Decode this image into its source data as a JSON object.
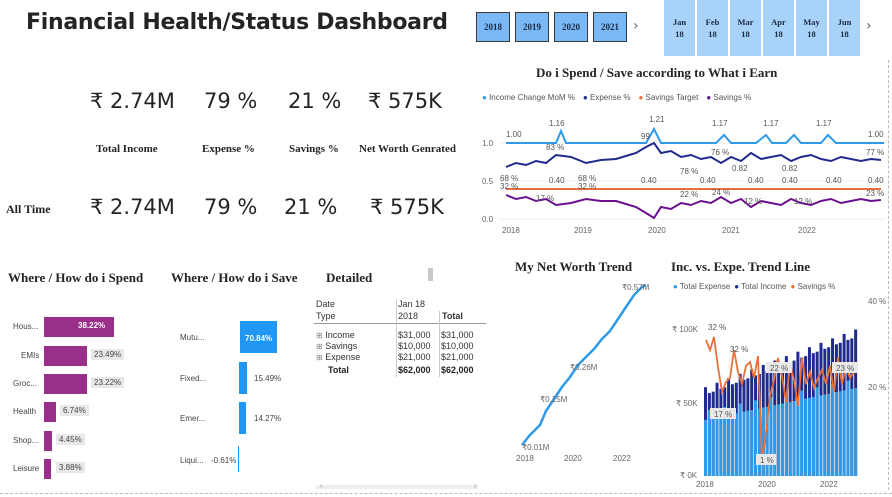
{
  "title": "Financial Health/Status Dashboard",
  "years": [
    "2018",
    "2019",
    "2020",
    "2021"
  ],
  "months": [
    {
      "m": "Jan",
      "y": "18"
    },
    {
      "m": "Feb",
      "y": "18"
    },
    {
      "m": "Mar",
      "y": "18"
    },
    {
      "m": "Apr",
      "y": "18"
    },
    {
      "m": "May",
      "y": "18"
    },
    {
      "m": "Jun",
      "y": "18"
    }
  ],
  "kpi": {
    "income": "₹ 2.74M",
    "expense": "79 %",
    "savings": "21 %",
    "networth": "₹ 575K",
    "income_lbl": "Total Income",
    "expense_lbl": "Expense %",
    "savings_lbl": "Savings %",
    "networth_lbl": "Net Worth Genrated",
    "alltime_lbl": "All Time",
    "income2": "₹ 2.74M",
    "expense2": "79 %",
    "savings2": "21 %",
    "networth2": "₹ 575K"
  },
  "colors": {
    "lightblue": "#2f9be8",
    "navy": "#1f2a8c",
    "orange": "#e8703a",
    "purple": "#6a0f8e",
    "magenta": "#9a2f8a",
    "blue": "#2196f3"
  },
  "spend": {
    "title": "Where / How do i Spend",
    "items": [
      {
        "label": "Hous...",
        "value": 38.22,
        "text": "38.22%"
      },
      {
        "label": "EMIs",
        "value": 23.49,
        "text": "23.49%"
      },
      {
        "label": "Groc...",
        "value": 23.22,
        "text": "23.22%"
      },
      {
        "label": "Health",
        "value": 6.74,
        "text": "6.74%"
      },
      {
        "label": "Shop...",
        "value": 4.45,
        "text": "4.45%"
      },
      {
        "label": "Leisure",
        "value": 3.88,
        "text": "3.88%"
      }
    ]
  },
  "save": {
    "title": "Where / How do i Save",
    "items": [
      {
        "label": "Mutu...",
        "value": 70.84,
        "text": "70.84%"
      },
      {
        "label": "Fixed...",
        "value": 15.49,
        "text": "15.49%"
      },
      {
        "label": "Emer...",
        "value": 14.27,
        "text": "14.27%"
      },
      {
        "label": "Liqui...",
        "value": -0.61,
        "text": "-0.61%"
      }
    ]
  },
  "detailed": {
    "title": "Detailed",
    "h1": "Date",
    "h2": "Type",
    "col_date": "Jan 18",
    "col_year": "2018",
    "col_total": "Total",
    "rows": [
      {
        "name": "Income",
        "v": "$31,000",
        "t": "$31,000"
      },
      {
        "name": "Savings",
        "v": "$10,000",
        "t": "$10,000"
      },
      {
        "name": "Expense",
        "v": "$21,000",
        "t": "$21,000"
      }
    ],
    "total": {
      "name": "Total",
      "v": "$62,000",
      "t": "$62,000"
    }
  },
  "line_chart": {
    "title": "Do i Spend / Save according to What i Earn",
    "legend": [
      "Income Change MoM %",
      "Expense %",
      "Savings Target",
      "Savings %"
    ],
    "y_ticks": [
      "1.0",
      "0.5",
      "0.0"
    ],
    "x_ticks": [
      "2018",
      "2019",
      "2020",
      "2021",
      "2022"
    ],
    "labels": [
      "1.00",
      "1.16",
      "1.21",
      "1.17",
      "1.17",
      "1.17",
      "1.00",
      "99",
      "83 %",
      "76 %",
      "77 %",
      "0.82",
      "0.82",
      "0.40",
      "0.40",
      "0.40",
      "0.40",
      "0.40",
      "0.40",
      "0.40",
      "68 %",
      "68 %",
      "32 %",
      "32 %",
      "78 %",
      "22 %",
      "24 %",
      "12 %",
      "12 %",
      "23 %",
      "17 %"
    ]
  },
  "networth": {
    "title": "My Net Worth Trend",
    "x_ticks": [
      "2018",
      "2020",
      "2022"
    ],
    "labels": [
      "₹0.01M",
      "₹0.15M",
      "₹0.26M",
      "₹0.57M"
    ]
  },
  "trend": {
    "title": "Inc. vs. Expe. Trend Line",
    "legend": [
      "Total Expense",
      "Total Income",
      "Savings %"
    ],
    "y_left": [
      "₹ 100K",
      "₹ 50K",
      "₹ 0K"
    ],
    "y_right": [
      "40 %",
      "20 %"
    ],
    "x_ticks": [
      "2018",
      "2020",
      "2022"
    ],
    "labels": [
      "32 %",
      "32 %",
      "22 %",
      "23 %",
      "17 %",
      "1 %"
    ]
  },
  "chart_data": [
    {
      "type": "line",
      "title": "Do i Spend / Save according to What i Earn",
      "x": [
        "2018",
        "2019",
        "2020",
        "2021",
        "2022"
      ],
      "series": [
        {
          "name": "Income Change MoM %",
          "values": [
            1.0,
            1.0,
            1.0,
            1.0,
            1.0
          ]
        },
        {
          "name": "Expense %",
          "values": [
            0.68,
            0.78,
            0.99,
            0.76,
            0.77
          ]
        },
        {
          "name": "Savings Target",
          "values": [
            0.4,
            0.4,
            0.4,
            0.4,
            0.4
          ]
        },
        {
          "name": "Savings %",
          "values": [
            0.32,
            0.22,
            0.01,
            0.24,
            0.23
          ]
        }
      ],
      "ylim": [
        0,
        1.25
      ]
    },
    {
      "type": "line",
      "title": "My Net Worth Trend",
      "x": [
        "2018",
        "2019",
        "2020",
        "2021",
        "2022"
      ],
      "series": [
        {
          "name": "",
          "values": [
            0.01,
            0.15,
            0.26,
            0.42,
            0.57
          ]
        }
      ]
    },
    {
      "type": "bar",
      "title": "Inc. vs. Expe. Trend Line",
      "x": [
        "2018",
        "2019",
        "2020",
        "2021",
        "2022"
      ],
      "series": [
        {
          "name": "Total Expense",
          "values": [
            45000,
            55000,
            60000,
            62000,
            65000
          ]
        },
        {
          "name": "Total Income",
          "values": [
            60000,
            75000,
            90000,
            100000,
            105000
          ]
        },
        {
          "name": "Savings %",
          "values": [
            32,
            22,
            1,
            22,
            23
          ]
        }
      ]
    }
  ]
}
